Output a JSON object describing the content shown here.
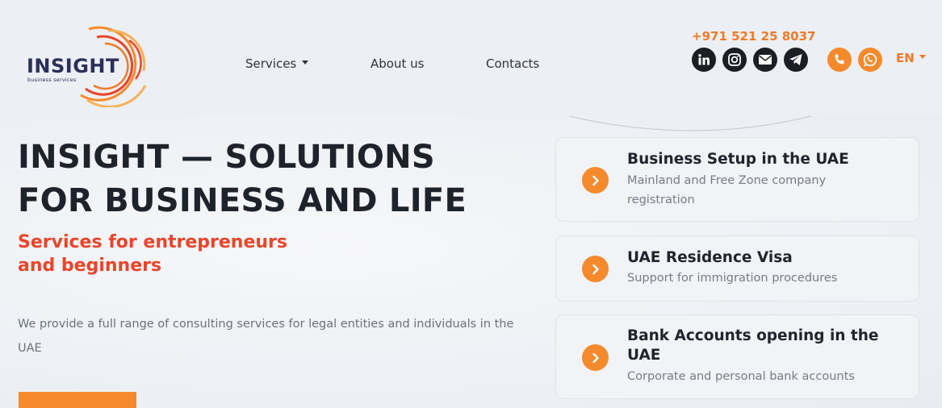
{
  "brand": {
    "name": "INSIGHT",
    "tagline": "business services",
    "colors": {
      "orange": "#f58a2d",
      "red": "#e8452a",
      "navy": "#2a2f5a"
    }
  },
  "nav": {
    "items": [
      {
        "label": "Services",
        "has_dropdown": true
      },
      {
        "label": "About us",
        "has_dropdown": false
      },
      {
        "label": "Contacts",
        "has_dropdown": false
      }
    ]
  },
  "contact": {
    "phone": "+971 521 25 8037",
    "social": [
      "linkedin-icon",
      "instagram-icon",
      "email-icon",
      "telegram-icon"
    ],
    "buttons": [
      "phone-icon",
      "whatsapp-icon"
    ],
    "language": "EN"
  },
  "hero": {
    "title_line1": "INSIGHT — SOLUTIONS",
    "title_line2": "FOR BUSINESS AND LIFE",
    "subtitle_line1": "Services for entrepreneurs",
    "subtitle_line2": "and beginners",
    "description": "We provide a full range of consulting services for legal entities and individuals in the UAE"
  },
  "services": [
    {
      "title": "Business Setup in the UAE",
      "description": "Mainland and Free Zone company registration"
    },
    {
      "title": "UAE Residence Visa",
      "description": "Support for immigration procedures"
    },
    {
      "title": "Bank Accounts opening in the UAE",
      "description": "Corporate and personal bank accounts"
    }
  ]
}
